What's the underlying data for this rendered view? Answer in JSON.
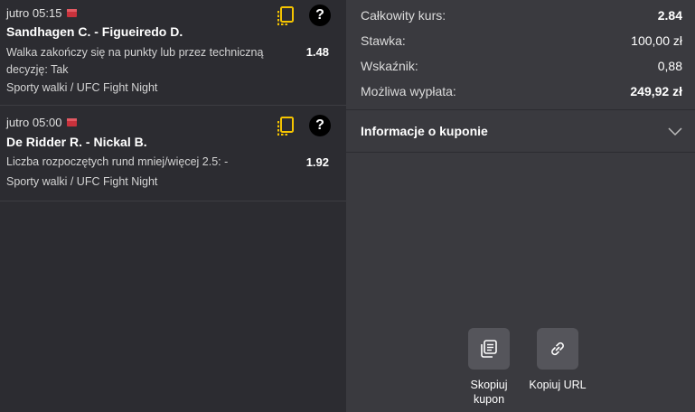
{
  "bets": [
    {
      "time": "jutro 05:15",
      "match": "Sandhagen C. - Figueiredo D.",
      "market": "Walka zakończy się na punkty lub przez techniczną decyzję: Tak",
      "odd": "1.48",
      "sport": "Sporty walki / UFC Fight Night",
      "help": "?"
    },
    {
      "time": "jutro 05:00",
      "match": "De Ridder R. - Nickal B.",
      "market": "Liczba rozpoczętych rund mniej/więcej 2.5: -",
      "odd": "1.92",
      "sport": "Sporty walki / UFC Fight Night",
      "help": "?"
    }
  ],
  "summary": {
    "total_odds_label": "Całkowity kurs:",
    "total_odds_value": "2.84",
    "stake_label": "Stawka:",
    "stake_value": "100,00 zł",
    "indicator_label": "Wskaźnik:",
    "indicator_value": "0,88",
    "payout_label": "Możliwa wypłata:",
    "payout_value": "249,92 zł"
  },
  "info": {
    "title": "Informacje o kuponie"
  },
  "actions": {
    "copy_coupon_line1": "Skopiuj",
    "copy_coupon_line2": "kupon",
    "copy_url": "Kopiuj URL"
  },
  "colors": {
    "accent_yellow": "#f5c400",
    "flag_red": "#c8323c",
    "left_bg": "#2c2c31",
    "right_bg": "#3a3a3f"
  }
}
